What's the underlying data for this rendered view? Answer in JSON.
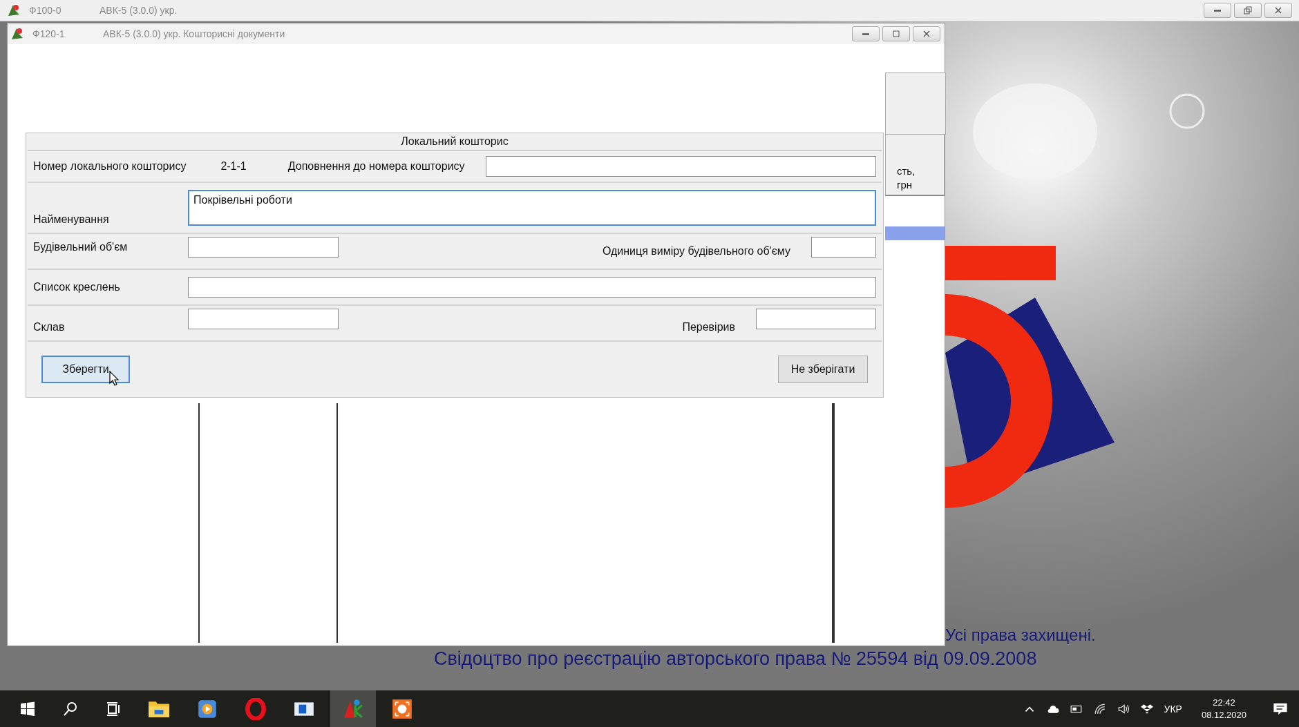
{
  "outer_window": {
    "app_code": "Ф100-0",
    "title": "АВК-5 (3.0.0) укр."
  },
  "inner_window": {
    "app_code": "Ф120-1",
    "title": "АВК-5 (3.0.0) укр.  Кошторисні документи"
  },
  "background_table": {
    "header_fragment": [
      "сть,",
      "грн"
    ]
  },
  "form": {
    "title": "Локальний кошторис",
    "number_label": "Номер локального кошторису",
    "number_value": "2-1-1",
    "addition_label": "Доповнення до номера кошторису",
    "name_label": "Найменування",
    "name_value": "Покрівельні роботи",
    "volume_label": "Будівельний об'єм",
    "unit_label": "Одиниця виміру будівельного об'єму",
    "drawings_label": "Список креслень",
    "author_label": "Склав",
    "checker_label": "Перевірив",
    "save_button": "Зберегти",
    "cancel_button": "Не зберігати"
  },
  "splash": {
    "rights": "Усі права захищені.",
    "certificate": "Свідоцтво про реєстрацію авторського права № 25594 від 09.09.2008"
  },
  "taskbar": {
    "language": "УКР",
    "time": "22:42",
    "date": "08.12.2020"
  }
}
